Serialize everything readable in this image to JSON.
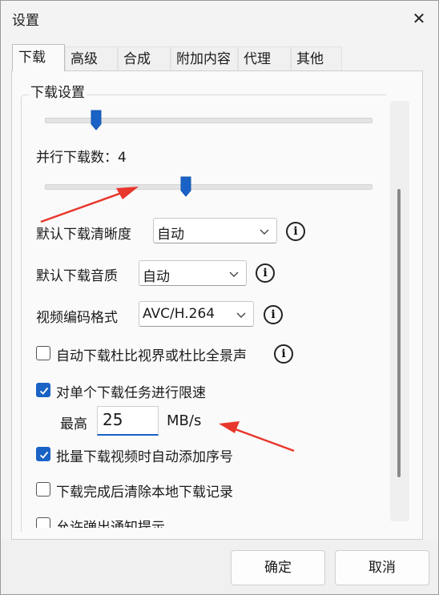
{
  "window": {
    "title": "设置",
    "close_glyph": "✕"
  },
  "tabs": [
    {
      "label": "下载",
      "active": true
    },
    {
      "label": "高级",
      "active": false
    },
    {
      "label": "合成",
      "active": false
    },
    {
      "label": "附加内容",
      "active": false
    },
    {
      "label": "代理",
      "active": false
    },
    {
      "label": "其他",
      "active": false
    }
  ],
  "download_settings": {
    "group_title": "下载设置",
    "slider1": {
      "level": 0.15
    },
    "concurrent": {
      "label": "并行下载数：4",
      "value": 4,
      "level": 0.43
    },
    "quality": {
      "label": "默认下载清晰度",
      "value": "自动"
    },
    "audio": {
      "label": "默认下载音质",
      "value": "自动"
    },
    "codec": {
      "label": "视频编码格式",
      "value": "AVC/H.264"
    },
    "dolby": {
      "label": "自动下载杜比视界或杜比全景声",
      "checked": false
    },
    "limit": {
      "label": "对单个下载任务进行限速",
      "checked": true
    },
    "max_speed": {
      "label": "最高",
      "value": "25",
      "unit": "MB/s"
    },
    "auto_number": {
      "label": "批量下载视频时自动添加序号",
      "checked": true
    },
    "clear_record": {
      "label": "下载完成后清除本地下载记录",
      "checked": false
    },
    "partial_item": {
      "label": "允许弹出通知提示",
      "checked": false
    }
  },
  "buttons": {
    "ok": "确定",
    "cancel": "取消"
  },
  "colors": {
    "accent": "#1a62c6",
    "annotation_arrow": "#e8372c"
  }
}
